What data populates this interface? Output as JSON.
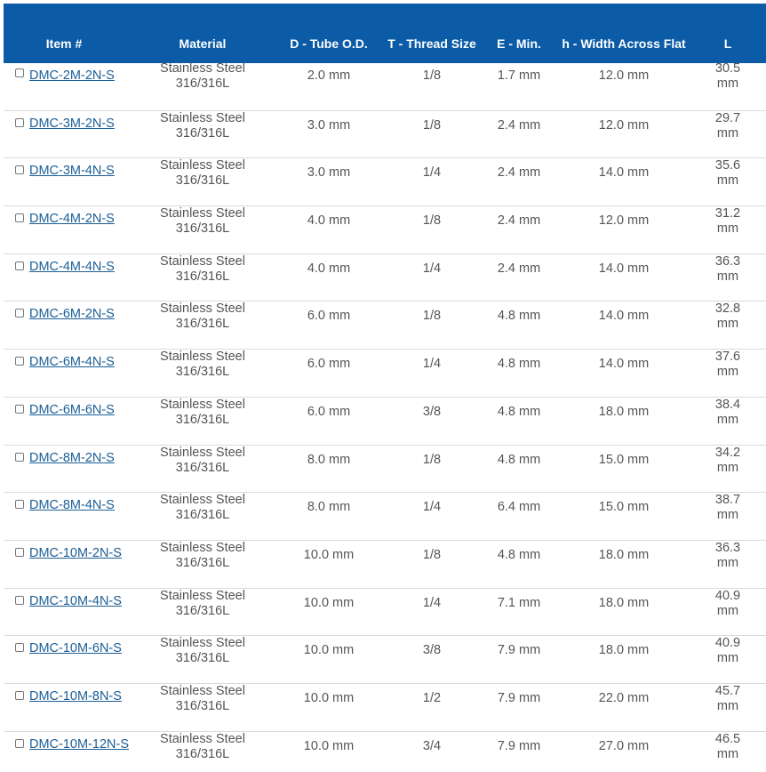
{
  "table": {
    "headers": {
      "item": "Item #",
      "material": "Material",
      "tube_od": "D - Tube O.D.",
      "thread_size": "T - Thread Size",
      "e_min": "E - Min.",
      "width_across_flat": "h - Width Across Flat",
      "length": "L"
    },
    "rows": [
      {
        "item": "DMC-2M-2N-S",
        "material_line1": "Stainless Steel",
        "material_line2": "316/316L",
        "tube_od": "2.0 mm",
        "thread_size": "1/8",
        "e_min": "1.7 mm",
        "width_across_flat": "12.0 mm",
        "length_value": "30.5",
        "length_unit": "mm"
      },
      {
        "item": "DMC-3M-2N-S",
        "material_line1": "Stainless Steel",
        "material_line2": "316/316L",
        "tube_od": "3.0 mm",
        "thread_size": "1/8",
        "e_min": "2.4 mm",
        "width_across_flat": "12.0 mm",
        "length_value": "29.7",
        "length_unit": "mm"
      },
      {
        "item": "DMC-3M-4N-S",
        "material_line1": "Stainless Steel",
        "material_line2": "316/316L",
        "tube_od": "3.0 mm",
        "thread_size": "1/4",
        "e_min": "2.4 mm",
        "width_across_flat": "14.0 mm",
        "length_value": "35.6",
        "length_unit": "mm"
      },
      {
        "item": "DMC-4M-2N-S",
        "material_line1": "Stainless Steel",
        "material_line2": "316/316L",
        "tube_od": "4.0 mm",
        "thread_size": "1/8",
        "e_min": "2.4 mm",
        "width_across_flat": "12.0 mm",
        "length_value": "31.2",
        "length_unit": "mm"
      },
      {
        "item": "DMC-4M-4N-S",
        "material_line1": "Stainless Steel",
        "material_line2": "316/316L",
        "tube_od": "4.0 mm",
        "thread_size": "1/4",
        "e_min": "2.4 mm",
        "width_across_flat": "14.0 mm",
        "length_value": "36.3",
        "length_unit": "mm"
      },
      {
        "item": "DMC-6M-2N-S",
        "material_line1": "Stainless Steel",
        "material_line2": "316/316L",
        "tube_od": "6.0 mm",
        "thread_size": "1/8",
        "e_min": "4.8 mm",
        "width_across_flat": "14.0 mm",
        "length_value": "32.8",
        "length_unit": "mm"
      },
      {
        "item": "DMC-6M-4N-S",
        "material_line1": "Stainless Steel",
        "material_line2": "316/316L",
        "tube_od": "6.0 mm",
        "thread_size": "1/4",
        "e_min": "4.8 mm",
        "width_across_flat": "14.0 mm",
        "length_value": "37.6",
        "length_unit": "mm"
      },
      {
        "item": "DMC-6M-6N-S",
        "material_line1": "Stainless Steel",
        "material_line2": "316/316L",
        "tube_od": "6.0 mm",
        "thread_size": "3/8",
        "e_min": "4.8 mm",
        "width_across_flat": "18.0 mm",
        "length_value": "38.4",
        "length_unit": "mm"
      },
      {
        "item": "DMC-8M-2N-S",
        "material_line1": "Stainless Steel",
        "material_line2": "316/316L",
        "tube_od": "8.0 mm",
        "thread_size": "1/8",
        "e_min": "4.8 mm",
        "width_across_flat": "15.0 mm",
        "length_value": "34.2",
        "length_unit": "mm"
      },
      {
        "item": "DMC-8M-4N-S",
        "material_line1": "Stainless Steel",
        "material_line2": "316/316L",
        "tube_od": "8.0 mm",
        "thread_size": "1/4",
        "e_min": "6.4 mm",
        "width_across_flat": "15.0 mm",
        "length_value": "38.7",
        "length_unit": "mm"
      },
      {
        "item": "DMC-10M-2N-S",
        "material_line1": "Stainless Steel",
        "material_line2": "316/316L",
        "tube_od": "10.0 mm",
        "thread_size": "1/8",
        "e_min": "4.8 mm",
        "width_across_flat": "18.0 mm",
        "length_value": "36.3",
        "length_unit": "mm"
      },
      {
        "item": "DMC-10M-4N-S",
        "material_line1": "Stainless Steel",
        "material_line2": "316/316L",
        "tube_od": "10.0 mm",
        "thread_size": "1/4",
        "e_min": "7.1 mm",
        "width_across_flat": "18.0 mm",
        "length_value": "40.9",
        "length_unit": "mm"
      },
      {
        "item": "DMC-10M-6N-S",
        "material_line1": "Stainless Steel",
        "material_line2": "316/316L",
        "tube_od": "10.0 mm",
        "thread_size": "3/8",
        "e_min": "7.9 mm",
        "width_across_flat": "18.0 mm",
        "length_value": "40.9",
        "length_unit": "mm"
      },
      {
        "item": "DMC-10M-8N-S",
        "material_line1": "Stainless Steel",
        "material_line2": "316/316L",
        "tube_od": "10.0 mm",
        "thread_size": "1/2",
        "e_min": "7.9 mm",
        "width_across_flat": "22.0 mm",
        "length_value": "45.7",
        "length_unit": "mm"
      },
      {
        "item": "DMC-10M-12N-S",
        "material_line1": "Stainless Steel",
        "material_line2": "316/316L",
        "tube_od": "10.0 mm",
        "thread_size": "3/4",
        "e_min": "7.9 mm",
        "width_across_flat": "27.0 mm",
        "length_value": "46.5",
        "length_unit": "mm"
      }
    ]
  },
  "colors": {
    "header_bg": "#0b5ba6",
    "header_text": "#ffffff",
    "link": "#1b5e96",
    "cell_text": "#555555",
    "row_divider": "#dadada"
  }
}
